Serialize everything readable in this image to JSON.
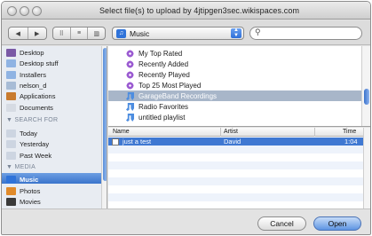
{
  "window": {
    "title": "Select file(s) to upload by 4jtipgen3sec.wikispaces.com"
  },
  "toolbar": {
    "back_glyph": "◀",
    "forward_glyph": "▶",
    "view_icon_glyph": "⠿",
    "view_list_glyph": "≡",
    "view_column_glyph": "▥",
    "location": "Music",
    "search_placeholder": "",
    "search_glyph": "⚲"
  },
  "sidebar": {
    "items_top": [
      {
        "label": "Desktop",
        "icon": "desktop-icon",
        "color": "#7b5aa6"
      },
      {
        "label": "Desktop stuff",
        "icon": "folder-icon",
        "color": "#8fb3e3"
      },
      {
        "label": "Installers",
        "icon": "folder-icon",
        "color": "#8fb3e3"
      },
      {
        "label": "nelson_d",
        "icon": "home-icon",
        "color": "#a8bcd6"
      },
      {
        "label": "Applications",
        "icon": "applications-icon",
        "color": "#c97b2e"
      },
      {
        "label": "Documents",
        "icon": "documents-icon",
        "color": "#d6dbe3"
      }
    ],
    "search_for_heading": "▼ SEARCH FOR",
    "search_for": [
      {
        "label": "Today",
        "icon": "clock-icon"
      },
      {
        "label": "Yesterday",
        "icon": "clock-icon"
      },
      {
        "label": "Past Week",
        "icon": "clock-icon"
      }
    ],
    "media_heading": "▼ MEDIA",
    "media": [
      {
        "label": "Music",
        "icon": "music-icon",
        "selected": true
      },
      {
        "label": "Photos",
        "icon": "photos-icon"
      },
      {
        "label": "Movies",
        "icon": "movies-icon"
      }
    ]
  },
  "playlists": [
    {
      "label": "My Top Rated",
      "icon": "smart-playlist-icon"
    },
    {
      "label": "Recently Added",
      "icon": "smart-playlist-icon"
    },
    {
      "label": "Recently Played",
      "icon": "smart-playlist-icon"
    },
    {
      "label": "Top 25 Most Played",
      "icon": "smart-playlist-icon"
    },
    {
      "label": "GarageBand Recordings",
      "icon": "playlist-icon",
      "selected": true
    },
    {
      "label": "Radio Favorites",
      "icon": "playlist-icon"
    },
    {
      "label": "untitled playlist",
      "icon": "playlist-icon"
    }
  ],
  "table": {
    "columns": [
      "Name",
      "Artist",
      "Time"
    ],
    "rows": [
      {
        "name": "just a test",
        "artist": "David",
        "time": "1:04",
        "selected": true
      }
    ]
  },
  "footer": {
    "cancel_label": "Cancel",
    "open_label": "Open"
  }
}
